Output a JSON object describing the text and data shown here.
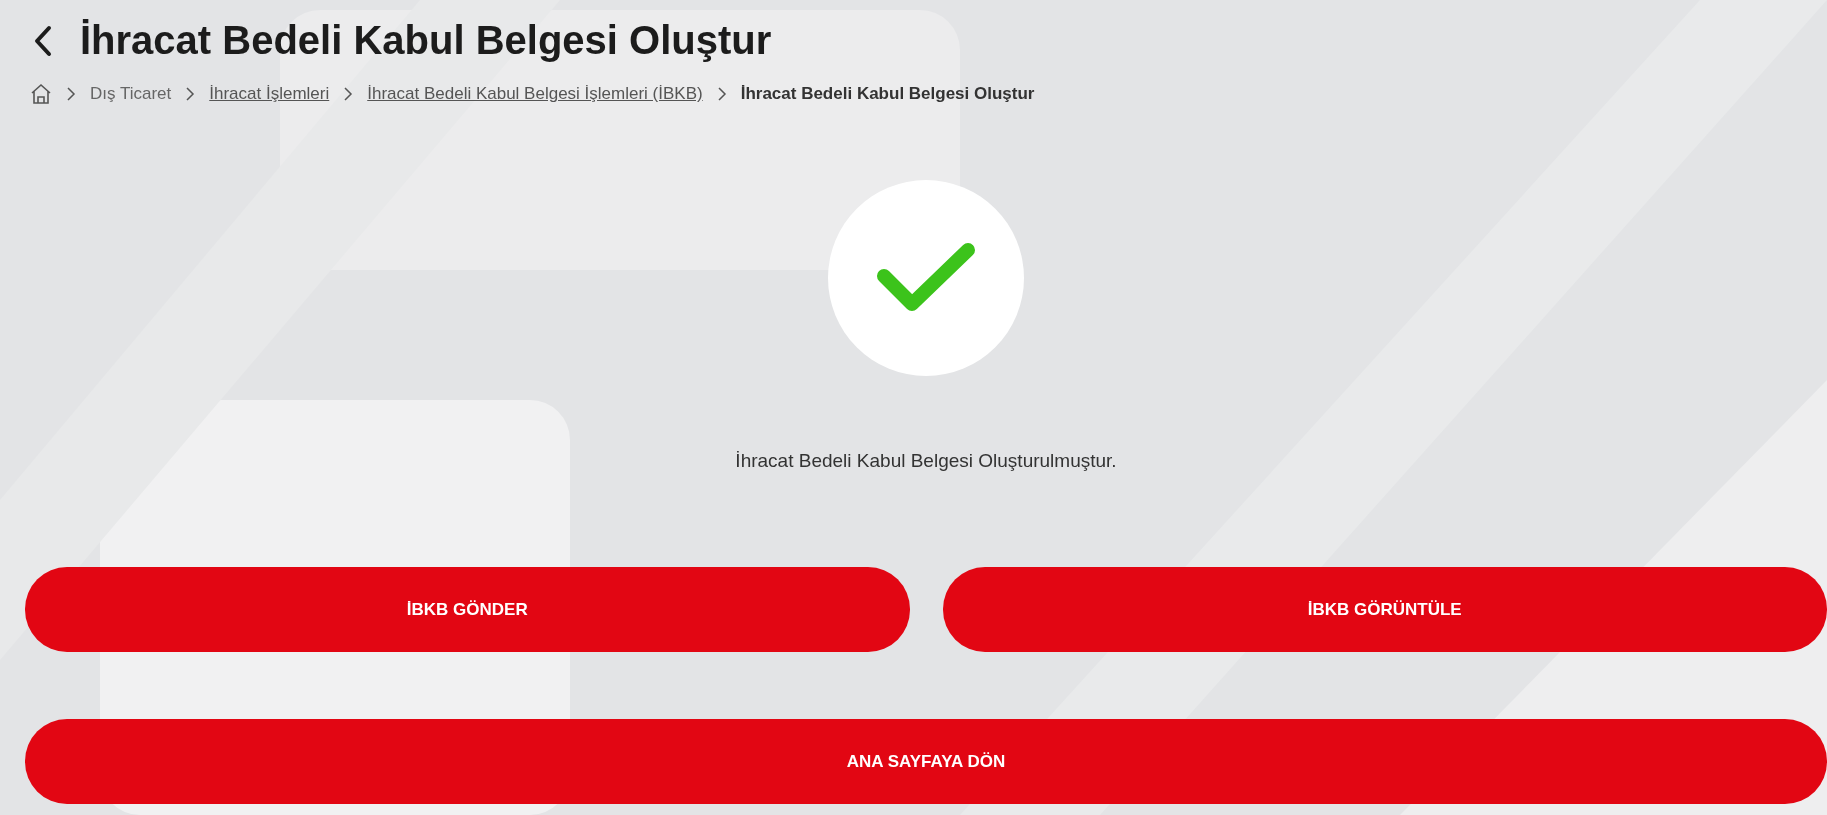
{
  "page": {
    "title": "İhracat Bedeli Kabul Belgesi Oluştur"
  },
  "breadcrumb": [
    {
      "label": "Dış Ticaret",
      "kind": "text"
    },
    {
      "label": "İhracat İşlemleri",
      "kind": "link"
    },
    {
      "label": "İhracat Bedeli Kabul Belgesi İşlemleri (İBKB)",
      "kind": "link"
    },
    {
      "label": "İhracat Bedeli Kabul Belgesi Oluştur",
      "kind": "current"
    }
  ],
  "result": {
    "success": true,
    "message": "İhracat Bedeli Kabul Belgesi Oluşturulmuştur."
  },
  "buttons": [
    {
      "label": "İBKB GÖNDER",
      "kind": "half"
    },
    {
      "label": "İBKB GÖRÜNTÜLE",
      "kind": "half"
    },
    {
      "label": "ANA SAYFAYA DÖN",
      "kind": "full"
    }
  ]
}
